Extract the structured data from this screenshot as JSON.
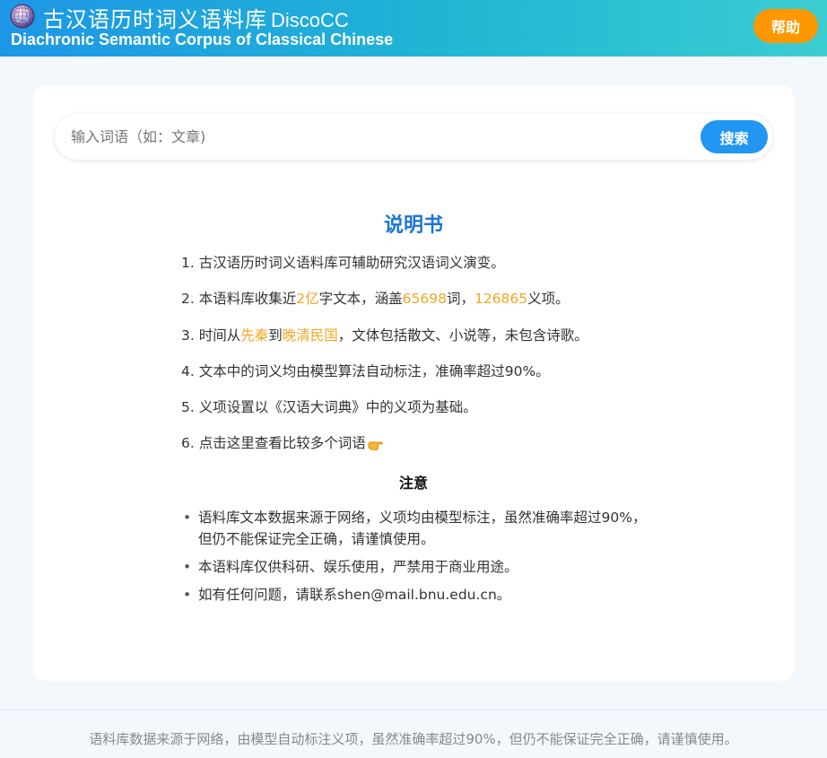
{
  "header": {
    "title_cn": "古汉语历时词义语料库",
    "title_short": "DiscoCC",
    "subtitle": "Diachronic Semantic Corpus of Classical Chinese",
    "help_label": "帮助",
    "logo_icon": "disco-ball-icon",
    "help_color": "#ff9800"
  },
  "search": {
    "placeholder": "输入词语（如：文章)",
    "button_label": "搜索",
    "button_color": "#2196f3"
  },
  "manual": {
    "title": "说明书",
    "items": [
      {
        "num": "1.",
        "text": "古汉语历时词义语料库可辅助研究汉语词义演变。"
      },
      {
        "num": "2.",
        "pre": "本语料库收集近",
        "hl1": "2亿",
        "mid1": "字文本，涵盖",
        "hl2": "65698",
        "mid2": "词，",
        "hl3": "126865",
        "post": "义项。"
      },
      {
        "num": "3.",
        "pre": "时间从",
        "hl1": "先秦",
        "mid1": "到",
        "hl2": "晚清民国",
        "post": "，文体包括散文、小说等，未包含诗歌。"
      },
      {
        "num": "4.",
        "text": "文本中的词义均由模型算法自动标注，准确率超过90%。"
      },
      {
        "num": "5.",
        "text": "义项设置以《汉语大词典》中的义项为基础。"
      },
      {
        "num": "6.",
        "text": "点击这里查看比较多个词语",
        "icon": "pointing-hand-icon"
      }
    ],
    "highlight_color": "#f5a623"
  },
  "notice": {
    "title": "注意",
    "items": [
      "语料库文本数据来源于网络，义项均由模型标注，虽然准确率超过90%，但仍不能保证完全正确，请谨慎使用。",
      "本语料库仅供科研、娱乐使用，严禁用于商业用途。",
      "如有任何问题，请联系shen@mail.bnu.edu.cn。"
    ]
  },
  "footer": {
    "text": "语料库数据来源于网络，由模型自动标注义项，虽然准确率超过90%，但仍不能保证完全正确，请谨慎使用。"
  }
}
